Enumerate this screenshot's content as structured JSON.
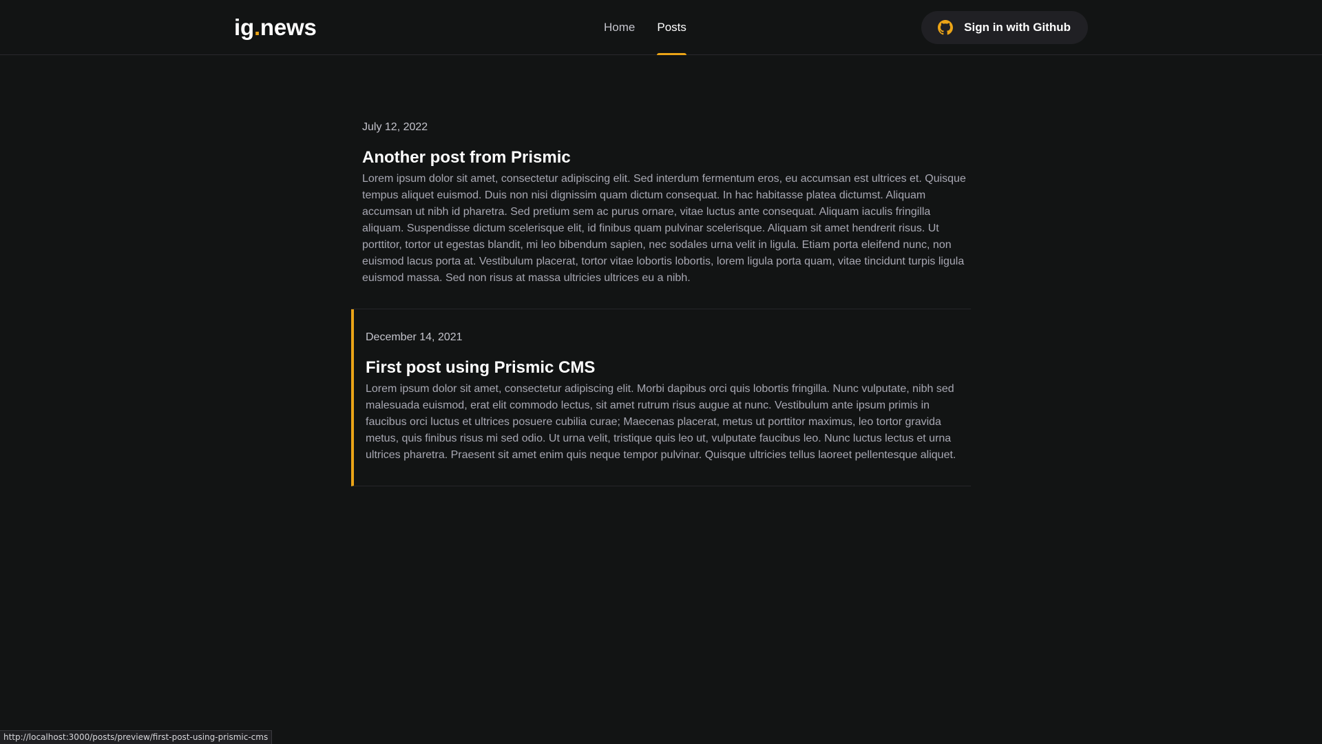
{
  "header": {
    "logo_prefix": "ig",
    "logo_dot": ".",
    "logo_suffix": "news",
    "nav": [
      {
        "label": "Home",
        "active": false
      },
      {
        "label": "Posts",
        "active": true
      }
    ],
    "signin_label": "Sign in with Github",
    "signin_icon": "github-icon"
  },
  "posts": [
    {
      "date": "July 12, 2022",
      "title": "Another post from Prismic",
      "excerpt": "Lorem ipsum dolor sit amet, consectetur adipiscing elit. Sed interdum fermentum eros, eu accumsan est ultrices et. Quisque tempus aliquet euismod. Duis non nisi dignissim quam dictum consequat. In hac habitasse platea dictumst. Aliquam accumsan ut nibh id pharetra. Sed pretium sem ac purus ornare, vitae luctus ante consequat. Aliquam iaculis fringilla aliquam. Suspendisse dictum scelerisque elit, id finibus quam pulvinar scelerisque. Aliquam sit amet hendrerit risus. Ut porttitor, tortor ut egestas blandit, mi leo bibendum sapien, nec sodales urna velit in ligula. Etiam porta eleifend nunc, non euismod lacus porta at. Vestibulum placerat, tortor vitae lobortis lobortis, lorem ligula porta quam, vitae tincidunt turpis ligula euismod massa. Sed non risus at massa ultricies ultrices eu a nibh."
    },
    {
      "date": "December 14, 2021",
      "title": "First post using Prismic CMS",
      "excerpt": "Lorem ipsum dolor sit amet, consectetur adipiscing elit. Morbi dapibus orci quis lobortis fringilla. Nunc vulputate, nibh sed malesuada euismod, erat elit commodo lectus, sit amet rutrum risus augue at nunc. Vestibulum ante ipsum primis in faucibus orci luctus et ultrices posuere cubilia curae; Maecenas placerat, metus ut porttitor maximus, leo tortor gravida metus, quis finibus risus mi sed odio. Ut urna velit, tristique quis leo ut, vulputate faucibus leo. Nunc luctus lectus et urna ultrices pharetra. Praesent sit amet enim quis neque tempor pulvinar. Quisque ultricies tellus laoreet pellentesque aliquet."
    }
  ],
  "status_url": "http://localhost:3000/posts/preview/first-post-using-prismic-cms",
  "colors": {
    "background": "#121414",
    "accent": "#eba417",
    "button_bg": "#202024"
  }
}
